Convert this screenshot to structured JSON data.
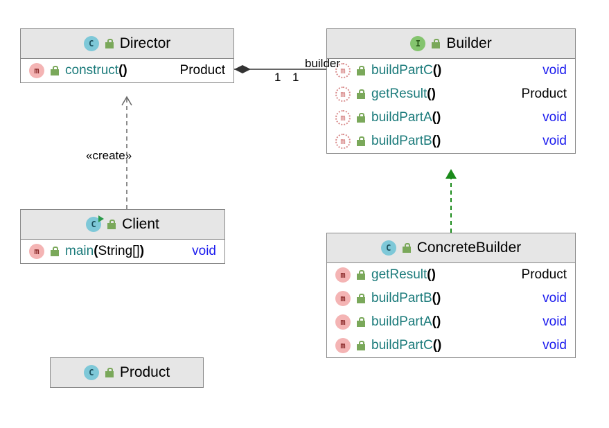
{
  "classes": {
    "director": {
      "name": "Director",
      "type": "c",
      "members": [
        {
          "kind": "m",
          "abstract": false,
          "name": "construct",
          "params": "",
          "ret": "Product",
          "retObj": true
        }
      ]
    },
    "builder": {
      "name": "Builder",
      "type": "i",
      "members": [
        {
          "kind": "m",
          "abstract": true,
          "name": "buildPartC",
          "params": "",
          "ret": "void",
          "retObj": false
        },
        {
          "kind": "m",
          "abstract": true,
          "name": "getResult",
          "params": "",
          "ret": "Product",
          "retObj": true
        },
        {
          "kind": "m",
          "abstract": true,
          "name": "buildPartA",
          "params": "",
          "ret": "void",
          "retObj": false
        },
        {
          "kind": "m",
          "abstract": true,
          "name": "buildPartB",
          "params": "",
          "ret": "void",
          "retObj": false
        }
      ]
    },
    "client": {
      "name": "Client",
      "type": "c",
      "runnable": true,
      "members": [
        {
          "kind": "m",
          "abstract": false,
          "name": "main",
          "params": "String[]",
          "ret": "void",
          "retObj": false
        }
      ]
    },
    "concretebuilder": {
      "name": "ConcreteBuilder",
      "type": "c",
      "members": [
        {
          "kind": "m",
          "abstract": false,
          "name": "getResult",
          "params": "",
          "ret": "Product",
          "retObj": true
        },
        {
          "kind": "m",
          "abstract": false,
          "name": "buildPartB",
          "params": "",
          "ret": "void",
          "retObj": false
        },
        {
          "kind": "m",
          "abstract": false,
          "name": "buildPartA",
          "params": "",
          "ret": "void",
          "retObj": false
        },
        {
          "kind": "m",
          "abstract": false,
          "name": "buildPartC",
          "params": "",
          "ret": "void",
          "retObj": false
        }
      ]
    },
    "product": {
      "name": "Product",
      "type": "c",
      "members": []
    }
  },
  "associations": {
    "builder": {
      "role": "builder",
      "mult_left": "1",
      "mult_right": "1"
    },
    "create": {
      "label": "«create»"
    }
  },
  "chart_data": {
    "type": "diagram",
    "uml_kind": "class",
    "classes": [
      {
        "name": "Director",
        "kind": "class",
        "methods": [
          {
            "name": "construct",
            "return": "Product"
          }
        ]
      },
      {
        "name": "Builder",
        "kind": "interface",
        "methods": [
          {
            "name": "buildPartC",
            "return": "void"
          },
          {
            "name": "getResult",
            "return": "Product"
          },
          {
            "name": "buildPartA",
            "return": "void"
          },
          {
            "name": "buildPartB",
            "return": "void"
          }
        ]
      },
      {
        "name": "Client",
        "kind": "class",
        "methods": [
          {
            "name": "main",
            "params": "String[]",
            "return": "void"
          }
        ]
      },
      {
        "name": "ConcreteBuilder",
        "kind": "class",
        "methods": [
          {
            "name": "getResult",
            "return": "Product"
          },
          {
            "name": "buildPartB",
            "return": "void"
          },
          {
            "name": "buildPartA",
            "return": "void"
          },
          {
            "name": "buildPartC",
            "return": "void"
          }
        ]
      },
      {
        "name": "Product",
        "kind": "class",
        "methods": []
      }
    ],
    "relations": [
      {
        "from": "Director",
        "to": "Builder",
        "type": "composition",
        "role": "builder",
        "multiplicity_from": "1",
        "multiplicity_to": "1"
      },
      {
        "from": "Client",
        "to": "Director",
        "type": "dependency",
        "stereotype": "create"
      },
      {
        "from": "ConcreteBuilder",
        "to": "Builder",
        "type": "realization"
      }
    ]
  }
}
